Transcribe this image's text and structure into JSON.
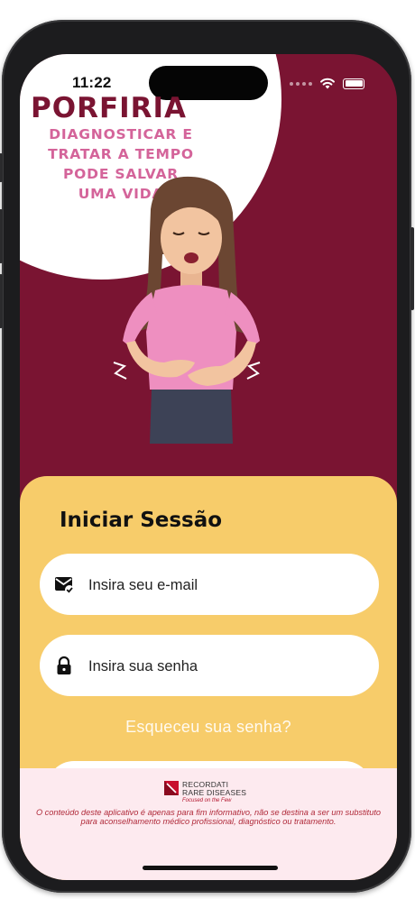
{
  "status_bar": {
    "time": "11:22",
    "icons": [
      "signal-dots-icon",
      "wifi-icon",
      "battery-icon"
    ]
  },
  "hero": {
    "title": "PORFIRIA",
    "subtitle_lines": [
      "DIAGNOSTICAR E",
      "TRATAR A TEMPO",
      "PODE SALVAR",
      "UMA VIDA"
    ]
  },
  "login": {
    "title": "Iniciar Sessão",
    "email_placeholder": "Insira seu e-mail",
    "password_placeholder": "Insira sua senha",
    "forgot_password": "Esqueceu sua senha?"
  },
  "footer": {
    "brand_line1": "RECORDATI",
    "brand_line2": "RARE DISEASES",
    "brand_tagline": "Focused on the Few",
    "disclaimer": "O conteúdo deste aplicativo é apenas para fim informativo, não se destina a ser um substituto para aconselhamento médico profissional, diagnóstico ou tratamento."
  },
  "colors": {
    "background_wine": "#7a1432",
    "panel_yellow": "#f7cc6a",
    "accent_pink": "#d4649a",
    "footer_pink": "#fdeaef"
  }
}
